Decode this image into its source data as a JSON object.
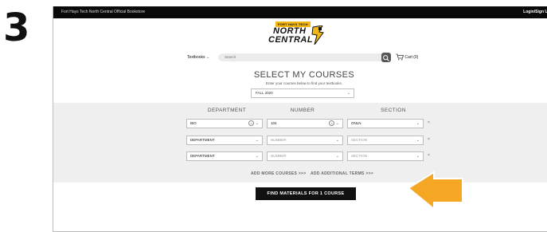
{
  "step_number": "3",
  "topbar": {
    "store_name": "Fort Hays Tech North Central Official Bookstore",
    "login_label": "Login/Sign U"
  },
  "logo": {
    "tagline": "FORT HAYS TECH",
    "line1": "NORTH",
    "line2": "CENTRAL"
  },
  "nav": {
    "textbooks_label": "Textbooks",
    "search_placeholder": "Search",
    "cart_label": "Cart (0)"
  },
  "course_selector": {
    "title": "SELECT MY COURSES",
    "subtitle": "Enter your courses below to find your textbooks.",
    "term": "FALL 2020",
    "columns": [
      "DEPARTMENT",
      "NUMBER",
      "SECTION"
    ],
    "rows": [
      {
        "department": "BIO",
        "number": "104",
        "section": "ONLN"
      },
      {
        "department": "DEPARTMENT",
        "number": "NUMBER",
        "section": "SECTION"
      },
      {
        "department": "DEPARTMENT",
        "number": "NUMBER",
        "section": "SECTION"
      }
    ],
    "add_more_label": "ADD MORE COURSES >>>",
    "add_terms_label": "ADD ADDITIONAL TERMS >>>",
    "find_button_label": "FIND MATERIALS FOR 1 COURSE"
  },
  "colors": {
    "topbar": "#0a0a0a",
    "logo_accent": "#f3b713",
    "panel": "#efefef",
    "button": "#111111",
    "arrow": "#f5a623"
  }
}
